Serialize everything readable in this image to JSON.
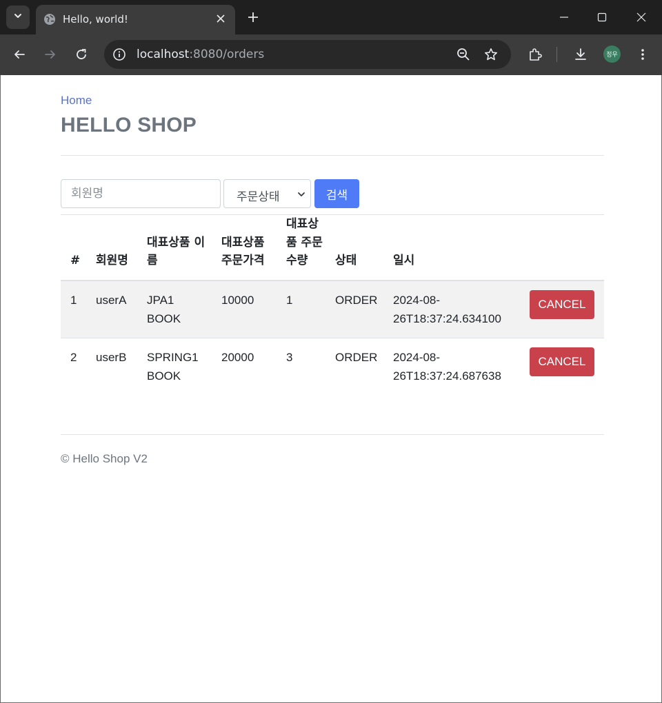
{
  "browser": {
    "tab_title": "Hello, world!",
    "url_host": "localhost",
    "url_path": ":8080/orders",
    "profile_initials": "정우",
    "icons": [
      "tab-list-icon",
      "globe-icon",
      "close-icon",
      "plus-icon",
      "minimize-icon",
      "maximize-icon",
      "close-window-icon",
      "back-icon",
      "forward-icon",
      "reload-icon",
      "info-icon",
      "zoom-icon",
      "star-icon",
      "extensions-icon",
      "download-icon",
      "more-icon"
    ]
  },
  "header": {
    "home_link": "Home",
    "brand": "HELLO SHOP"
  },
  "search": {
    "member_placeholder": "회원명",
    "status_selected": "주문상태",
    "submit_label": "검색"
  },
  "table": {
    "headers": [
      "#",
      "회원명",
      "대표상품 이름",
      "대표상품 주문가격",
      "대표상품 주문수량",
      "상태",
      "일시",
      ""
    ],
    "rows": [
      {
        "id": "1",
        "member": "userA",
        "item": "JPA1 BOOK",
        "price": "10000",
        "count": "1",
        "status": "ORDER",
        "date": "2024-08-26T18:37:24.634100",
        "action": "CANCEL"
      },
      {
        "id": "2",
        "member": "userB",
        "item": "SPRING1 BOOK",
        "price": "20000",
        "count": "3",
        "status": "ORDER",
        "date": "2024-08-26T18:37:24.687638",
        "action": "CANCEL"
      }
    ]
  },
  "footer": {
    "text": "© Hello Shop V2"
  },
  "colors": {
    "primary": "#4f7cf6",
    "danger": "#c8414b",
    "brand_text": "#6c757d",
    "link": "#5a72c8"
  }
}
